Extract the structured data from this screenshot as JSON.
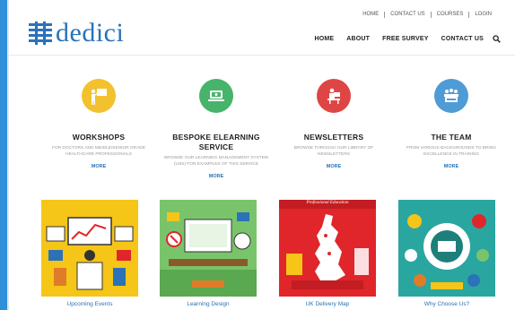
{
  "brand": {
    "name": "dedici",
    "color": "#2b72b8"
  },
  "utility_nav": [
    "HOME",
    "CONTACT US",
    "COURSES",
    "LOGIN"
  ],
  "main_nav": [
    "HOME",
    "ABOUT",
    "FREE SURVEY",
    "CONTACT US"
  ],
  "features": [
    {
      "title": "WORKSHOPS",
      "desc": "FOR DOCTORS AND MIDDLE/SENIOR GRADE HEALTHCARE PROFESSIONALS",
      "more": "MORE",
      "color": "#f2c12e",
      "icon": "presenter-icon"
    },
    {
      "title": "BESPOKE ELEARNING SERVICE",
      "desc": "BROWSE OUR LEARNING MANAGEMENT SYSTEM (LMS) FOR EXAMPLES OF THIS SERVICE",
      "more": "MORE",
      "color": "#47b36b",
      "icon": "laptop-icon"
    },
    {
      "title": "NEWSLETTERS",
      "desc": "BROWSE THROUGH OUR LIBRARY OF NEWSLETTERS",
      "more": "MORE",
      "color": "#e04545",
      "icon": "reader-icon"
    },
    {
      "title": "THE TEAM",
      "desc": "FROM VARIOUS BACKGROUNDS TO BRING EXCELLENCE IN TRAINING",
      "more": "MORE",
      "color": "#4f9bd6",
      "icon": "team-icon"
    }
  ],
  "tiles": [
    {
      "caption": "Upcoming Events",
      "bg": "#f5c518"
    },
    {
      "caption": "Learning Design",
      "bg": "#79c46a"
    },
    {
      "caption": "UK Delivery Map",
      "bg": "#e0262a",
      "banner": "Professional Education"
    },
    {
      "caption": "Why Choose Us?",
      "bg": "#2aa6a0"
    }
  ]
}
